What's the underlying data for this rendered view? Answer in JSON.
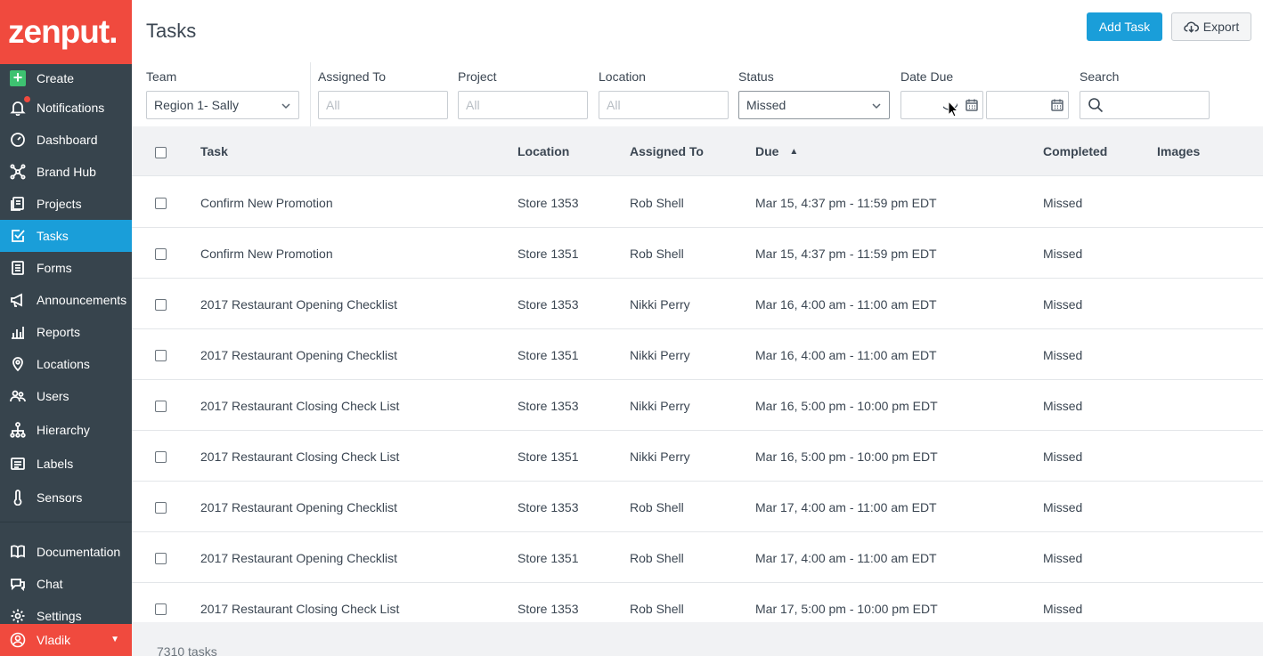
{
  "brand": {
    "logo_text": "zenput.",
    "accent": "#f04a3e",
    "active": "#1a9ed9"
  },
  "sidebar": {
    "items": [
      {
        "label": "Create",
        "icon": "plus-icon"
      },
      {
        "label": "Notifications",
        "icon": "bell-icon"
      },
      {
        "label": "Dashboard",
        "icon": "dashboard-icon"
      },
      {
        "label": "Brand Hub",
        "icon": "hub-icon"
      },
      {
        "label": "Projects",
        "icon": "projects-icon"
      },
      {
        "label": "Tasks",
        "icon": "tasks-icon"
      },
      {
        "label": "Forms",
        "icon": "forms-icon"
      },
      {
        "label": "Announcements",
        "icon": "megaphone-icon"
      },
      {
        "label": "Reports",
        "icon": "reports-icon"
      },
      {
        "label": "Locations",
        "icon": "location-pin-icon"
      },
      {
        "label": "Users",
        "icon": "users-icon"
      },
      {
        "label": "Hierarchy",
        "icon": "hierarchy-icon"
      },
      {
        "label": "Labels",
        "icon": "labels-icon"
      },
      {
        "label": "Sensors",
        "icon": "thermometer-icon"
      },
      {
        "label": "Documentation",
        "icon": "book-icon"
      },
      {
        "label": "Chat",
        "icon": "chat-icon"
      },
      {
        "label": "Settings",
        "icon": "gear-icon"
      }
    ],
    "user": {
      "name": "Vladik",
      "icon": "user-circle-icon"
    }
  },
  "header": {
    "title": "Tasks",
    "add_task": "Add Task",
    "export": "Export"
  },
  "filters": {
    "team": {
      "label": "Team",
      "value": "Region 1- Sally"
    },
    "assigned_to": {
      "label": "Assigned To",
      "placeholder": "All"
    },
    "project": {
      "label": "Project",
      "placeholder": "All"
    },
    "location": {
      "label": "Location",
      "placeholder": "All"
    },
    "status": {
      "label": "Status",
      "value": "Missed"
    },
    "date_due": {
      "label": "Date Due"
    },
    "search": {
      "label": "Search"
    }
  },
  "table": {
    "columns": {
      "task": "Task",
      "location": "Location",
      "assigned_to": "Assigned To",
      "due": "Due",
      "completed": "Completed",
      "images": "Images"
    },
    "rows": [
      {
        "task": "Confirm New Promotion",
        "location": "Store 1353",
        "assigned_to": "Rob Shell",
        "due": "Mar 15, 4:37 pm - 11:59 pm EDT",
        "completed": "Missed"
      },
      {
        "task": "Confirm New Promotion",
        "location": "Store 1351",
        "assigned_to": "Rob Shell",
        "due": "Mar 15, 4:37 pm - 11:59 pm EDT",
        "completed": "Missed"
      },
      {
        "task": "2017 Restaurant Opening Checklist",
        "location": "Store 1353",
        "assigned_to": "Nikki Perry",
        "due": "Mar 16, 4:00 am - 11:00 am EDT",
        "completed": "Missed"
      },
      {
        "task": "2017 Restaurant Opening Checklist",
        "location": "Store 1351",
        "assigned_to": "Nikki Perry",
        "due": "Mar 16, 4:00 am - 11:00 am EDT",
        "completed": "Missed"
      },
      {
        "task": "2017 Restaurant Closing Check List",
        "location": "Store 1353",
        "assigned_to": "Nikki Perry",
        "due": "Mar 16, 5:00 pm - 10:00 pm EDT",
        "completed": "Missed"
      },
      {
        "task": "2017 Restaurant Closing Check List",
        "location": "Store 1351",
        "assigned_to": "Nikki Perry",
        "due": "Mar 16, 5:00 pm - 10:00 pm EDT",
        "completed": "Missed"
      },
      {
        "task": "2017 Restaurant Opening Checklist",
        "location": "Store 1353",
        "assigned_to": "Rob Shell",
        "due": "Mar 17, 4:00 am - 11:00 am EDT",
        "completed": "Missed"
      },
      {
        "task": "2017 Restaurant Opening Checklist",
        "location": "Store 1351",
        "assigned_to": "Rob Shell",
        "due": "Mar 17, 4:00 am - 11:00 am EDT",
        "completed": "Missed"
      },
      {
        "task": "2017 Restaurant Closing Check List",
        "location": "Store 1353",
        "assigned_to": "Rob Shell",
        "due": "Mar 17, 5:00 pm - 10:00 pm EDT",
        "completed": "Missed"
      }
    ],
    "footer": "7310 tasks"
  }
}
